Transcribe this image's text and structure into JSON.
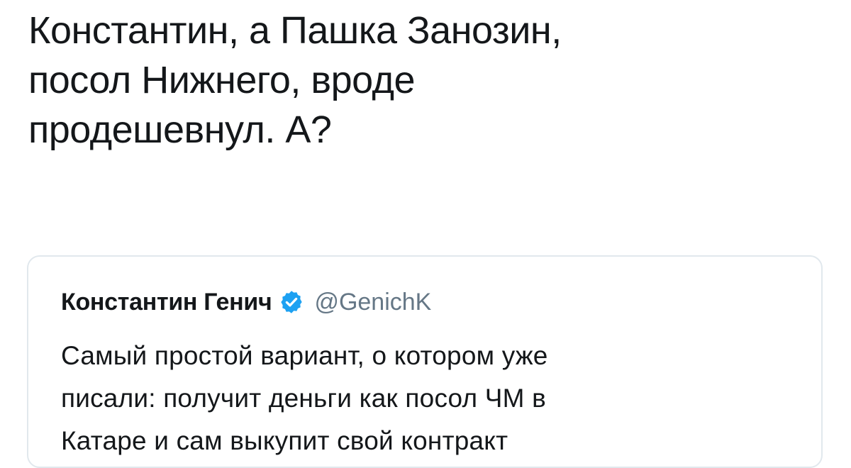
{
  "tweet": {
    "text_lines": [
      "Константин, а Пашка Занозин,",
      "посол Нижнего, вроде",
      "продешевнул. А?"
    ]
  },
  "quoted_tweet": {
    "author_name": "Константин Генич",
    "handle": "@GenichK",
    "verified_icon": "verified-badge-icon",
    "text_lines": [
      "Самый простой вариант, о котором уже",
      "писали: получит деньги как посол ЧМ в",
      "Катаре и сам выкупит свой контракт"
    ]
  },
  "colors": {
    "text": "#14171a",
    "secondary_text": "#657786",
    "verified_blue": "#1da1f2",
    "card_border": "#e1e8ed"
  }
}
